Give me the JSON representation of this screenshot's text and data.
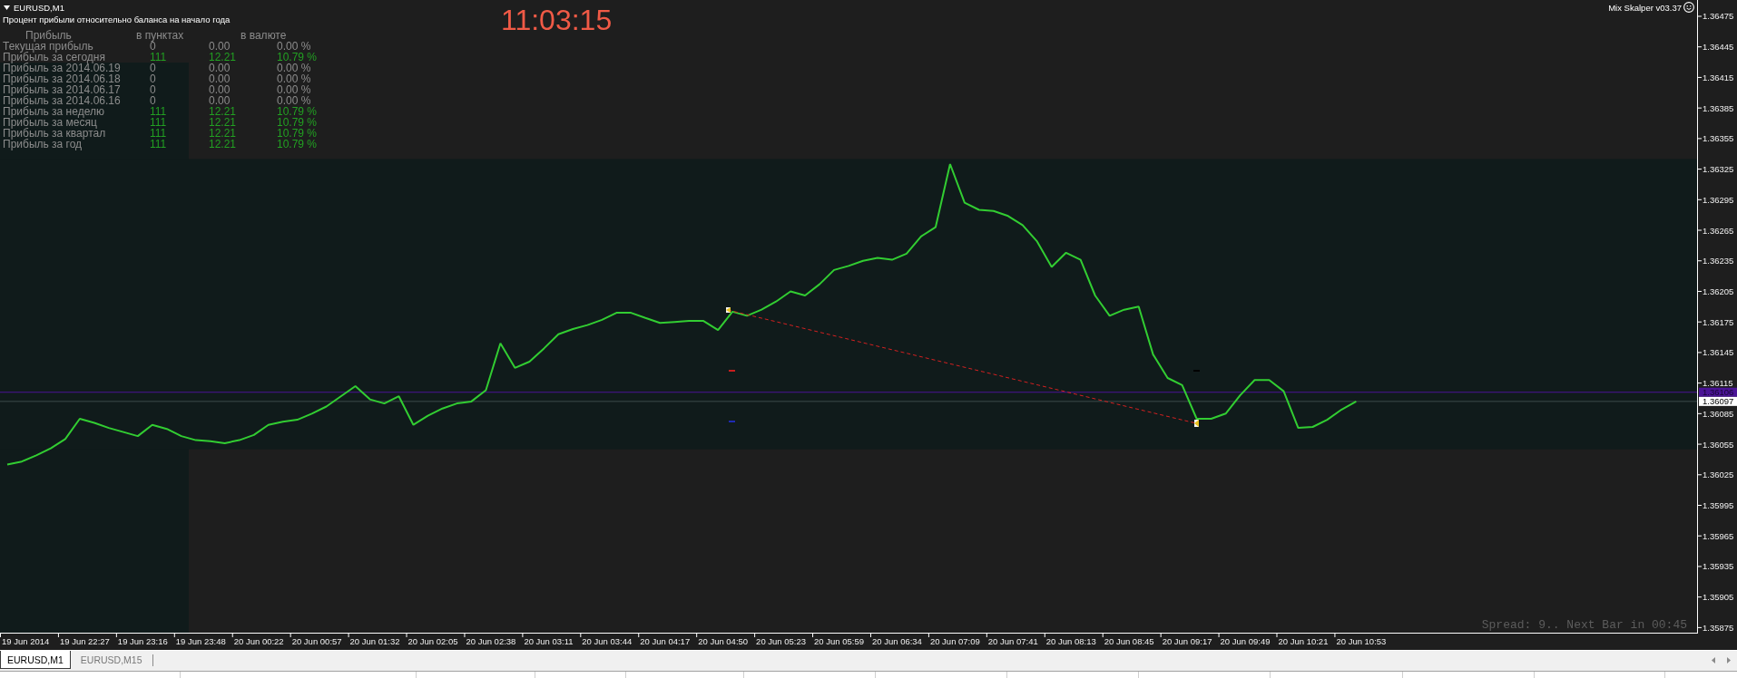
{
  "chart_window": {
    "symbol": "EURUSD,M1",
    "subtitle": "Процент прибыли относительно баланса на начало года",
    "clock": "11:03:15",
    "expert_name": "Mix Skalper v03.37",
    "status_text": "Spread: 9.. Next Bar in 00:45",
    "profit_table": {
      "columns": [
        "Прибыль",
        "в пунктах",
        "в валюте"
      ],
      "rows": [
        {
          "label": "Текущая прибыль",
          "points": "0",
          "currency": "0.00",
          "percent": "0.00 %",
          "color": "#8c8c8c"
        },
        {
          "label": "Прибыль за сегодня",
          "points": "111",
          "currency": "12.21",
          "percent": "10.79 %",
          "color": "#22a022"
        },
        {
          "label": "Прибыль за 2014.06.19",
          "points": "0",
          "currency": "0.00",
          "percent": "0.00 %",
          "color": "#8c8c8c"
        },
        {
          "label": "Прибыль за 2014.06.18",
          "points": "0",
          "currency": "0.00",
          "percent": "0.00 %",
          "color": "#8c8c8c"
        },
        {
          "label": "Прибыль за 2014.06.17",
          "points": "0",
          "currency": "0.00",
          "percent": "0.00 %",
          "color": "#8c8c8c"
        },
        {
          "label": "Прибыль за 2014.06.16",
          "points": "0",
          "currency": "0.00",
          "percent": "0.00 %",
          "color": "#8c8c8c"
        },
        {
          "label": "Прибыль за неделю",
          "points": "111",
          "currency": "12.21",
          "percent": "10.79 %",
          "color": "#22a022"
        },
        {
          "label": "Прибыль за месяц",
          "points": "111",
          "currency": "12.21",
          "percent": "10.79 %",
          "color": "#22a022"
        },
        {
          "label": "Прибыль за квартал",
          "points": "111",
          "currency": "12.21",
          "percent": "10.79 %",
          "color": "#22a022"
        },
        {
          "label": "Прибыль за год",
          "points": "111",
          "currency": "12.21",
          "percent": "10.79 %",
          "color": "#22a022"
        }
      ]
    },
    "chart_data": {
      "type": "line",
      "categories": [
        null,
        "19 Jun 2014",
        null,
        null,
        null,
        "19 Jun 22:27",
        null,
        null,
        null,
        "19 Jun 23:16",
        null,
        null,
        null,
        "19 Jun 23:48",
        null,
        null,
        null,
        "20 Jun 00:22",
        null,
        null,
        null,
        "20 Jun 00:57",
        null,
        null,
        null,
        "20 Jun 01:32",
        null,
        null,
        null,
        "20 Jun 02:05",
        null,
        null,
        null,
        "20 Jun 02:38",
        null,
        null,
        null,
        "20 Jun 03:11",
        null,
        null,
        null,
        "20 Jun 03:44",
        null,
        null,
        null,
        "20 Jun 04:17",
        null,
        null,
        null,
        "20 Jun 04:50",
        null,
        null,
        null,
        "20 Jun 05:23",
        null,
        null,
        null,
        "20 Jun 05:59",
        null,
        null,
        null,
        "20 Jun 06:34",
        null,
        null,
        null,
        "20 Jun 07:09",
        null,
        null,
        null,
        "20 Jun 07:41",
        null,
        null,
        null,
        "20 Jun 08:13",
        null,
        null,
        null,
        "20 Jun 08:45",
        null,
        null,
        null,
        "20 Jun 09:17",
        null,
        null,
        null,
        "20 Jun 09:49",
        null,
        null,
        null,
        "20 Jun 10:21",
        null,
        null,
        null,
        "20 Jun 10:53",
        null,
        null,
        null,
        null,
        null,
        null,
        null,
        null,
        null,
        null,
        null,
        null,
        null,
        null,
        null,
        null,
        null,
        null,
        null,
        null,
        null,
        null,
        null
      ],
      "series": [
        {
          "color": "#32cd32",
          "values": [
            1.36035,
            1.36038,
            1.36044,
            1.36051,
            1.3606,
            1.3608,
            1.36076,
            1.36071,
            1.36067,
            1.36063,
            1.36074,
            1.3607,
            1.36063,
            1.36059,
            1.36058,
            1.36056,
            1.36059,
            1.36064,
            1.36074,
            1.36077,
            1.36079,
            1.36085,
            1.36092,
            1.36102,
            1.36112,
            1.36099,
            1.36095,
            1.36102,
            1.36074,
            1.36083,
            1.3609,
            1.36095,
            1.36097,
            1.36108,
            1.36154,
            1.3613,
            1.36136,
            1.36149,
            1.36163,
            1.36168,
            1.36172,
            1.36177,
            1.36184,
            1.36184,
            1.36179,
            1.36174,
            1.36175,
            1.36176,
            1.36176,
            1.36167,
            1.36185,
            1.36181,
            1.36187,
            1.36195,
            1.36205,
            1.36201,
            1.36212,
            1.36226,
            1.3623,
            1.36235,
            1.36238,
            1.36236,
            1.36242,
            1.36259,
            1.36268,
            1.3633,
            1.36292,
            1.36285,
            1.36284,
            1.36279,
            1.3627,
            1.36254,
            1.36229,
            1.36243,
            1.36236,
            1.36201,
            1.36181,
            1.36187,
            1.3619,
            1.36143,
            1.3612,
            1.36113,
            1.3608,
            1.3608,
            1.36085,
            1.36103,
            1.36118,
            1.36118,
            1.36107,
            1.36071,
            1.36072,
            1.36079,
            1.36089,
            1.36097,
            null,
            null,
            null,
            null,
            null,
            null,
            null,
            null,
            null,
            null,
            null,
            null,
            null,
            null,
            null,
            null,
            null,
            null,
            null,
            null,
            null,
            null,
            null
          ]
        }
      ],
      "ylim": [
        1.3587,
        1.36491
      ],
      "yticks": [
        1.36475,
        1.36445,
        1.36415,
        1.36385,
        1.36355,
        1.36325,
        1.36295,
        1.36265,
        1.36235,
        1.36205,
        1.36175,
        1.36145,
        1.36115,
        1.36085,
        1.36055,
        1.36025,
        1.35995,
        1.35965,
        1.35935,
        1.35905,
        1.35875
      ],
      "ref_lines": [
        {
          "axis": "y",
          "value": 1.36106,
          "label": "1.36106",
          "color": "#4b1496"
        },
        {
          "axis": "y",
          "value": 1.36097,
          "label": "1.36097",
          "color": "#3c4a4a"
        }
      ],
      "bands": [
        {
          "axis": "y",
          "from": 1.3605,
          "to": 1.36335
        }
      ]
    }
  },
  "tabs": [
    {
      "label": "EURUSD,M1",
      "selected": true
    },
    {
      "label": "EURUSD,M15",
      "selected": false
    }
  ]
}
